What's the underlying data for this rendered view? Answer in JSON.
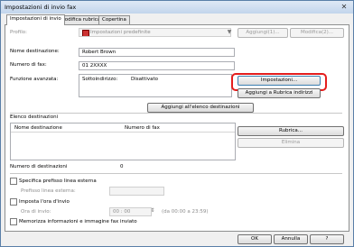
{
  "window": {
    "title": "Impostazioni di invio fax",
    "close_glyph": "✕"
  },
  "tabs": [
    {
      "label": "Impostazioni di invio"
    },
    {
      "label": "Modifica rubrica"
    },
    {
      "label": "Copertina"
    }
  ],
  "profile": {
    "label": "Profilo:",
    "value": "Impostazioni predefinite",
    "add_button": "Aggiungi(1)...",
    "edit_button": "Modifica(2)..."
  },
  "destination": {
    "name_label": "Nome destinazione:",
    "name_value": "Robert Brown",
    "fax_label": "Numero di fax:",
    "fax_value": "01 2XXXX"
  },
  "advanced": {
    "label": "Funzione avanzata:",
    "subaddress_label": "Sottoindirizzo:",
    "subaddress_value": "Disattivato",
    "settings_button": "Impostazioni...",
    "add_to_addressbook_button": "Aggiungi a Rubrica indirizzi"
  },
  "add_to_list_button": "Aggiungi all'elenco destinazioni",
  "dest_list": {
    "label": "Elenco destinazioni",
    "columns": [
      "Nome destinazione",
      "Numero di fax"
    ],
    "addressbook_button": "Rubrica...",
    "delete_button": "Elimina",
    "count_label": "Numero di destinazioni",
    "count_value": "0"
  },
  "options": {
    "external_prefix_label": "Specifica prefisso linea esterna",
    "external_prefix_field_label": "Prefisso linea esterna:",
    "send_time_label": "Imposta l'ora d'invio",
    "send_time_field_label": "Ora di invio:",
    "send_time_value": "00   :   00",
    "send_time_range": "(da 00:00 a 23:59)",
    "save_info_label": "Memorizza informazioni e immagine fax inviato"
  },
  "footer": {
    "ok": "OK",
    "cancel": "Annulla",
    "help": "?"
  }
}
